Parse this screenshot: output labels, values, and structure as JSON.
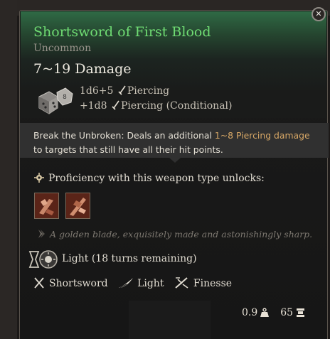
{
  "item": {
    "name": "Shortsword of First Blood",
    "rarity": "Uncommon",
    "damage_summary": "7~19 Damage",
    "damage_lines": [
      {
        "dice": "1d6+5",
        "type": "Piercing"
      },
      {
        "dice": "+1d8",
        "type": "Piercing (Conditional)"
      }
    ],
    "passive": {
      "name": "Break the Unbroken:",
      "text_pre": " Deals an additional ",
      "highlight": "1~8 Piercing damage",
      "text_post": " to targets that still have all their hit points."
    },
    "proficiency_label": "Proficiency with this weapon type unlocks:",
    "actions": [
      {
        "icon": "weapon-action-icon-1"
      },
      {
        "icon": "weapon-action-icon-2"
      }
    ],
    "flavor_text": "A golden blade, exquisitely made and astonishingly sharp.",
    "condition": "Light (18 turns remaining)",
    "properties": [
      {
        "label": "Shortsword",
        "icon": "crossed-swords-icon"
      },
      {
        "label": "Light",
        "icon": "feather-icon"
      },
      {
        "label": "Finesse",
        "icon": "finesse-icon"
      }
    ],
    "weight": "0.9",
    "value": "65"
  },
  "colors": {
    "name": "#6fdc73",
    "highlight": "#d7a766",
    "header_green": "#2f6a45"
  }
}
